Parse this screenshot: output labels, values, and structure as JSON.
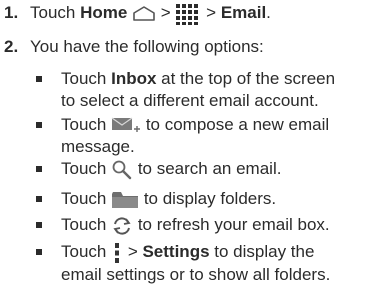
{
  "steps": [
    {
      "num": "1.",
      "prefix": "Touch ",
      "home": "Home",
      "sep1": " > ",
      "sep2": " > ",
      "email": "Email",
      "end": "."
    },
    {
      "num": "2.",
      "text": "You have the following options:"
    }
  ],
  "options": [
    {
      "pre": "Touch ",
      "bold": "Inbox",
      "post": " at the top of the screen",
      "line2": "to select a different email account."
    },
    {
      "pre": "Touch ",
      "icon": "compose-mail-icon",
      "post": " to compose a new email",
      "line2": "message."
    },
    {
      "pre": "Touch ",
      "icon": "search-icon",
      "post": " to search an email."
    },
    {
      "pre": "Touch ",
      "icon": "folder-icon",
      "post": " to display folders."
    },
    {
      "pre": "Touch ",
      "icon": "refresh-icon",
      "post": " to refresh your email box."
    },
    {
      "pre": "Touch ",
      "icon": "menu-icon",
      "sep": " > ",
      "bold": "Settings",
      "post": " to display the",
      "line2": "email settings or to show all folders."
    }
  ]
}
